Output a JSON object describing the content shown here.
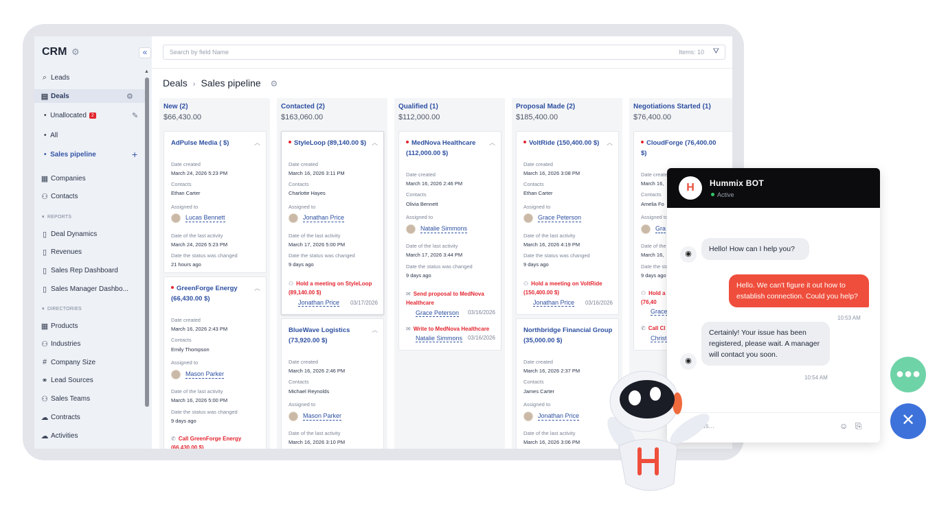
{
  "sidebar": {
    "title": "CRM",
    "collapse_label": "«",
    "nav": [
      {
        "label": "Leads",
        "icon": "search-icon"
      },
      {
        "label": "Deals",
        "icon": "deals-icon"
      }
    ],
    "deals_sub": [
      {
        "label": "Unallocated",
        "badge": "2"
      },
      {
        "label": "All"
      },
      {
        "label": "Sales pipeline"
      }
    ],
    "nav2": [
      {
        "label": "Companies",
        "icon": "companies-icon"
      },
      {
        "label": "Contacts",
        "icon": "contacts-icon"
      }
    ],
    "reports_label": "REPORTS",
    "reports": [
      {
        "label": "Deal Dynamics"
      },
      {
        "label": "Revenues"
      },
      {
        "label": "Sales Rep Dashboard"
      },
      {
        "label": "Sales Manager Dashbo..."
      }
    ],
    "directories_label": "DIRECTORIES",
    "directories": [
      {
        "label": "Products"
      },
      {
        "label": "Industries"
      },
      {
        "label": "Company Size"
      },
      {
        "label": "Lead Sources"
      },
      {
        "label": "Sales Teams"
      },
      {
        "label": "Contracts"
      },
      {
        "label": "Activities"
      }
    ]
  },
  "search": {
    "placeholder": "Search by field Name",
    "items": "Items: 10"
  },
  "breadcrumb": {
    "root": "Deals",
    "current": "Sales pipeline"
  },
  "labels": {
    "date_created": "Date created",
    "contacts": "Contacts",
    "assigned_to": "Assigned to",
    "last_activity": "Date of the last activity",
    "status_changed": "Date the status was changed"
  },
  "columns": [
    {
      "title": "New (2)",
      "amount": "$66,430.00",
      "cards": [
        {
          "title": "AdPulse Media ( $)",
          "dot": false,
          "created": "March 24, 2026 5:23 PM",
          "contact": "Ethan Carter",
          "assignee": "Lucas Bennett",
          "last_activity": "March 24, 2026 5:23 PM",
          "status_changed": "21 hours ago"
        },
        {
          "title": "GreenForge Energy (66,430.00 $)",
          "dot": true,
          "created": "March 16, 2026 2:43 PM",
          "contact": "Emily Thompson",
          "assignee": "Mason Parker",
          "last_activity": "March 16, 2026 5:00 PM",
          "status_changed": "9 days ago",
          "activity": "Call GreenForge Energy (66,430.00 $)"
        }
      ]
    },
    {
      "title": "Contacted (2)",
      "amount": "$163,060.00",
      "cards": [
        {
          "title": "StyleLoop (89,140.00 $)",
          "dot": true,
          "created": "March 16, 2026 3:11 PM",
          "contact": "Charlotte Hayes",
          "assignee": "Jonathan Price",
          "last_activity": "March 17, 2026 5:00 PM",
          "status_changed": "9 days ago",
          "activity": "Hold a meeting on StyleLoop (89,140.00 $)",
          "activity_person": "Jonathan Price",
          "activity_date": "03/17/2026"
        },
        {
          "title": "BlueWave Logistics (73,920.00 $)",
          "dot": false,
          "created": "March 16, 2026 2:46 PM",
          "contact": "Michael Reynolds",
          "assignee": "Mason Parker",
          "last_activity": "March 16, 2026 3:10 PM"
        }
      ]
    },
    {
      "title": "Qualified (1)",
      "amount": "$112,000.00",
      "cards": [
        {
          "title": "MedNova Healthcare (112,000.00 $)",
          "dot": true,
          "created": "March 16, 2026 2:46 PM",
          "contact": "Olivia Bennett",
          "assignee": "Natalie Simmons",
          "last_activity": "March 17, 2026 3:44 PM",
          "status_changed": "9 days ago",
          "activity": "Send proposal to MedNova Healthcare",
          "activity_person": "Grace Peterson",
          "activity_date": "03/16/2026",
          "activity2": "Write to MedNova Healthcare",
          "activity2_person": "Natalie Simmons",
          "activity2_date": "03/16/2026"
        }
      ]
    },
    {
      "title": "Proposal Made (2)",
      "amount": "$185,400.00",
      "cards": [
        {
          "title": "VoltRide (150,400.00 $)",
          "dot": true,
          "created": "March 16, 2026 3:08 PM",
          "contact": "Ethan Carter",
          "assignee": "Grace Peterson",
          "last_activity": "March 16, 2026 4:19 PM",
          "status_changed": "9 days ago",
          "activity": "Hold a meeting on VoltRide (150,400.00 $)",
          "activity_person": "Jonathan Price",
          "activity_date": "03/16/2026"
        },
        {
          "title": "Northbridge Financial Group (35,000.00 $)",
          "dot": false,
          "created": "March 16, 2026 2:37 PM",
          "contact": "James Carter",
          "assignee": "Jonathan Price",
          "last_activity": "March 16, 2026 3:06 PM"
        }
      ]
    },
    {
      "title": "Negotiations Started (1)",
      "amount": "$76,400.00",
      "cards": [
        {
          "title": "CloudForge (76,400.00 $)",
          "dot": true,
          "created": "March 16,",
          "contact": "Amelia Fo",
          "assignee": "Gra",
          "last_activity": "March 16,",
          "status_changed": "9 days ago",
          "activity": "Hold a (76,40",
          "activity_person": "Grace",
          "activity2": "Call Cl",
          "activity2_person": "Christ"
        }
      ]
    }
  ],
  "chat": {
    "bot_name": "Hummix BOT",
    "logo": "H",
    "status": "Active",
    "messages": [
      {
        "from": "bot",
        "text": "Hello! How can I help you?"
      },
      {
        "from": "user",
        "text": "Hello. We can't figure it out how to establish connection. Could you help?",
        "time": "10:53 AM"
      },
      {
        "from": "bot",
        "text": "Certainly! Your issue has been registered, please wait. A manager will contact you soon.",
        "time": "10:54 AM"
      }
    ],
    "input_placeholder": "act us..."
  },
  "colors": {
    "accent": "#2c4fa0",
    "brand": "#ef4e3c",
    "fab_chat": "#6fd3a8",
    "fab_close": "#3d72db"
  }
}
